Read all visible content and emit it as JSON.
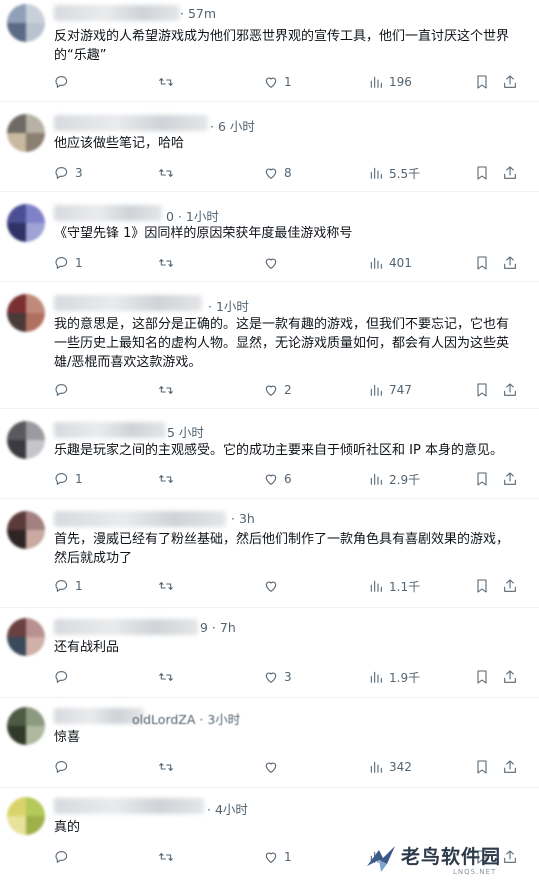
{
  "replies": [
    {
      "time": "· 57m",
      "text": "反对游戏的人希望游戏成为他们邪恶世界观的宣传工具，他们一直讨厌这个世界的“乐趣”",
      "reply_count": "",
      "retweet_count": "",
      "like_count": "1",
      "view_count": "196",
      "avatar_colors": [
        "#8fa0b8",
        "#c9d0dc",
        "#5b6a87",
        "#b9c2cf"
      ]
    },
    {
      "time": "· 6 小时",
      "text": "他应该做些笔记，哈哈",
      "reply_count": "3",
      "retweet_count": "",
      "like_count": "8",
      "view_count": "5.5千",
      "avatar_colors": [
        "#6f6a63",
        "#b7b1a6",
        "#c8b8a0",
        "#8b7f72"
      ]
    },
    {
      "time": "0 · 1小时",
      "text": "《守望先锋 1》因同样的原因荣获年度最佳游戏称号",
      "reply_count": "1",
      "retweet_count": "",
      "like_count": "",
      "view_count": "401",
      "avatar_colors": [
        "#4b4f93",
        "#7f82c8",
        "#2f3266",
        "#9fa3d6"
      ]
    },
    {
      "time": "· 1小时",
      "text": "我的意思是，这部分是正确的。这是一款有趣的游戏，但我们不要忘记，它也有一些历史上最知名的虚构人物。显然，无论游戏质量如何，都会有人因为这些英雄/恶棍而喜欢这款游戏。",
      "reply_count": "",
      "retweet_count": "",
      "like_count": "2",
      "view_count": "747",
      "avatar_colors": [
        "#7a2f33",
        "#c08a7a",
        "#4a3a3a",
        "#b07060"
      ]
    },
    {
      "time": "5 小时",
      "text": "乐趣是玩家之间的主观感受。它的成功主要来自于倾听社区和 IP 本身的意见。",
      "reply_count": "1",
      "retweet_count": "",
      "like_count": "6",
      "view_count": "2.9千",
      "avatar_colors": [
        "#5a5a5e",
        "#9a9aa0",
        "#3a3a40",
        "#c5c5ca"
      ]
    },
    {
      "time": "· 3h",
      "text": "首先，漫威已经有了粉丝基础，然后他们制作了一款角色具有喜剧效果的游戏，然后就成功了",
      "reply_count": "1",
      "retweet_count": "",
      "like_count": "",
      "view_count": "1.1千",
      "avatar_colors": [
        "#5b3a3a",
        "#a48080",
        "#2e2424",
        "#c9a9a0"
      ]
    },
    {
      "time": "9 · 7h",
      "text": "还有战利品",
      "reply_count": "",
      "retweet_count": "",
      "like_count": "3",
      "view_count": "1.9千",
      "avatar_colors": [
        "#6a4040",
        "#b89090",
        "#3a4a5a",
        "#d0b0a8"
      ]
    },
    {
      "time": "oldLordZA · 3小时",
      "text": "惊喜",
      "reply_count": "",
      "retweet_count": "",
      "like_count": "",
      "view_count": "342",
      "avatar_colors": [
        "#4d5a44",
        "#8d9a80",
        "#2f3a2a",
        "#b0b8a0"
      ]
    },
    {
      "time": "· 4小时",
      "text": "真的",
      "reply_count": "",
      "retweet_count": "",
      "like_count": "1",
      "view_count": "",
      "avatar_colors": [
        "#d9d46a",
        "#b4c95a",
        "#e8e29a",
        "#9fb04a"
      ]
    }
  ],
  "watermark": {
    "title": "老鸟软件园",
    "subtitle": "LNQS.NET"
  },
  "colors": {
    "text": "#0f1419",
    "muted": "#536471",
    "divider": "#eff3f4"
  },
  "icons": [
    "reply-icon",
    "retweet-icon",
    "like-icon",
    "views-icon",
    "bookmark-icon",
    "share-icon"
  ]
}
